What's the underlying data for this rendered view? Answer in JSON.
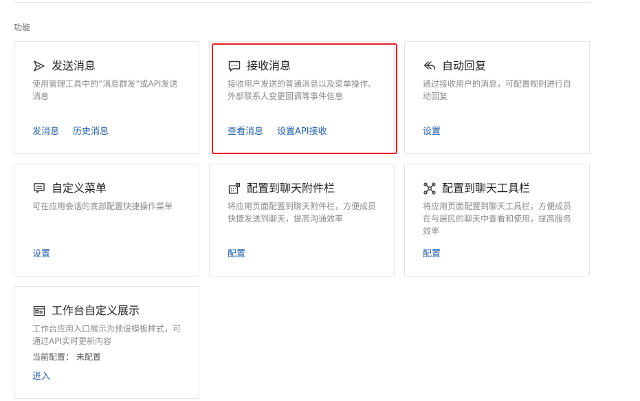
{
  "section": {
    "label": "功能"
  },
  "cards": [
    {
      "icon": "send-icon",
      "title": "发送消息",
      "desc": "使用管理工具中的“消息群发”或API发送消息",
      "links": [
        "发消息",
        "历史消息"
      ]
    },
    {
      "icon": "chat-bubble-icon",
      "title": "接收消息",
      "desc": "接收用户发送的普通消息以及菜单操作、外部联系人变更回调等事件信息",
      "links": [
        "查看消息",
        "设置API接收"
      ]
    },
    {
      "icon": "reply-icon",
      "title": "自动回复",
      "desc": "通过接收用户的消息，可配置规则进行自动回复",
      "links": [
        "设置"
      ]
    },
    {
      "icon": "menu-list-icon",
      "title": "自定义菜单",
      "desc": "可在应用会话的底部配置快捷操作菜单",
      "links": [
        "设置"
      ]
    },
    {
      "icon": "attachment-bar-icon",
      "title": "配置到聊天附件栏",
      "desc": "将应用页面配置到聊天附件栏，方便成员快捷发送到聊天，提高沟通效率",
      "links": [
        "配置"
      ]
    },
    {
      "icon": "toolbar-icon",
      "title": "配置到聊天工具栏",
      "desc": "将应用页面配置到聊天工具栏，方便成员在与居民的聊天中查看和使用，提高服务效率",
      "links": [
        "配置"
      ]
    },
    {
      "icon": "workbench-card-icon",
      "title": "工作台自定义展示",
      "desc": "工作台应用入口展示为预设模板样式，可通过API实时更新内容",
      "extra": "当前配置： 未配置",
      "links": [
        "进入"
      ]
    }
  ],
  "colors": {
    "link": "#1f5ea8",
    "highlight": "#e21f26",
    "border": "#e4e4e4"
  }
}
